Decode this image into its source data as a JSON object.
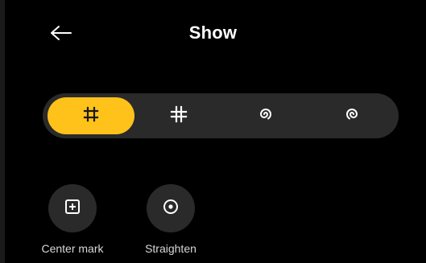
{
  "header": {
    "title": "Show",
    "back_icon": "arrow-left-icon"
  },
  "modes": {
    "selected_index": 0,
    "options": [
      {
        "icon": "grid-thirds-icon"
      },
      {
        "icon": "grid-hash-icon"
      },
      {
        "icon": "golden-spiral-icon"
      },
      {
        "icon": "spiral-flipped-icon"
      }
    ]
  },
  "tools": [
    {
      "label": "Center mark",
      "icon": "center-mark-icon"
    },
    {
      "label": "Straighten",
      "icon": "level-icon"
    }
  ],
  "colors": {
    "background": "#000000",
    "accent": "#ffc21a",
    "surface": "#2a2a2a",
    "text": "#ffffff"
  }
}
